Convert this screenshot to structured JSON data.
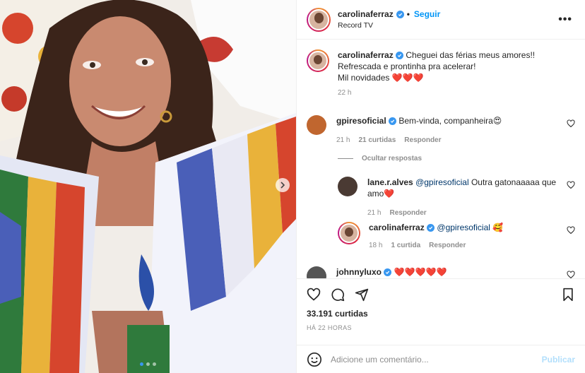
{
  "post": {
    "author": "carolinaferraz",
    "follow_label": "Seguir",
    "location": "Record TV",
    "more_label": "•••",
    "caption": {
      "username": "carolinaferraz",
      "line1": "Cheguei das férias meus amores!! Refrescada e prontinha pra acelerar!",
      "line2": "Mil novidades ❤️❤️❤️",
      "time": "22 h"
    }
  },
  "comments": [
    {
      "username": "gpiresoficial",
      "text": "Bem-vinda, companheira😍",
      "time": "21 h",
      "likes": "21 curtidas",
      "reply": "Responder"
    }
  ],
  "hide_replies_label": "Ocultar respostas",
  "replies": [
    {
      "username": "lane.r.alves",
      "mention": "@gpiresoficial",
      "text": "Outra gatonaaaaa que amo❤️",
      "time": "21 h",
      "reply": "Responder"
    },
    {
      "username": "carolinaferraz",
      "mention": "@gpiresoficial",
      "text": "🥰",
      "time": "18 h",
      "likes": "1 curtida",
      "reply": "Responder"
    }
  ],
  "partial_comment": {
    "username": "johnnyluxo",
    "text": "❤️❤️❤️❤️❤️"
  },
  "stats": {
    "likes": "33.191 curtidas",
    "timestamp": "HÁ 22 HORAS"
  },
  "composer": {
    "placeholder": "Adicione um comentário...",
    "publish_label": "Publicar"
  },
  "carousel": {
    "count": 3,
    "active": 0
  },
  "colors": {
    "accent": "#0095f6",
    "verified": "#3897f0",
    "muted": "#8e8e8e"
  },
  "icons": [
    "next-arrow-icon",
    "verified-icon",
    "heart-icon",
    "comment-icon",
    "share-icon",
    "bookmark-icon",
    "emoji-icon"
  ]
}
